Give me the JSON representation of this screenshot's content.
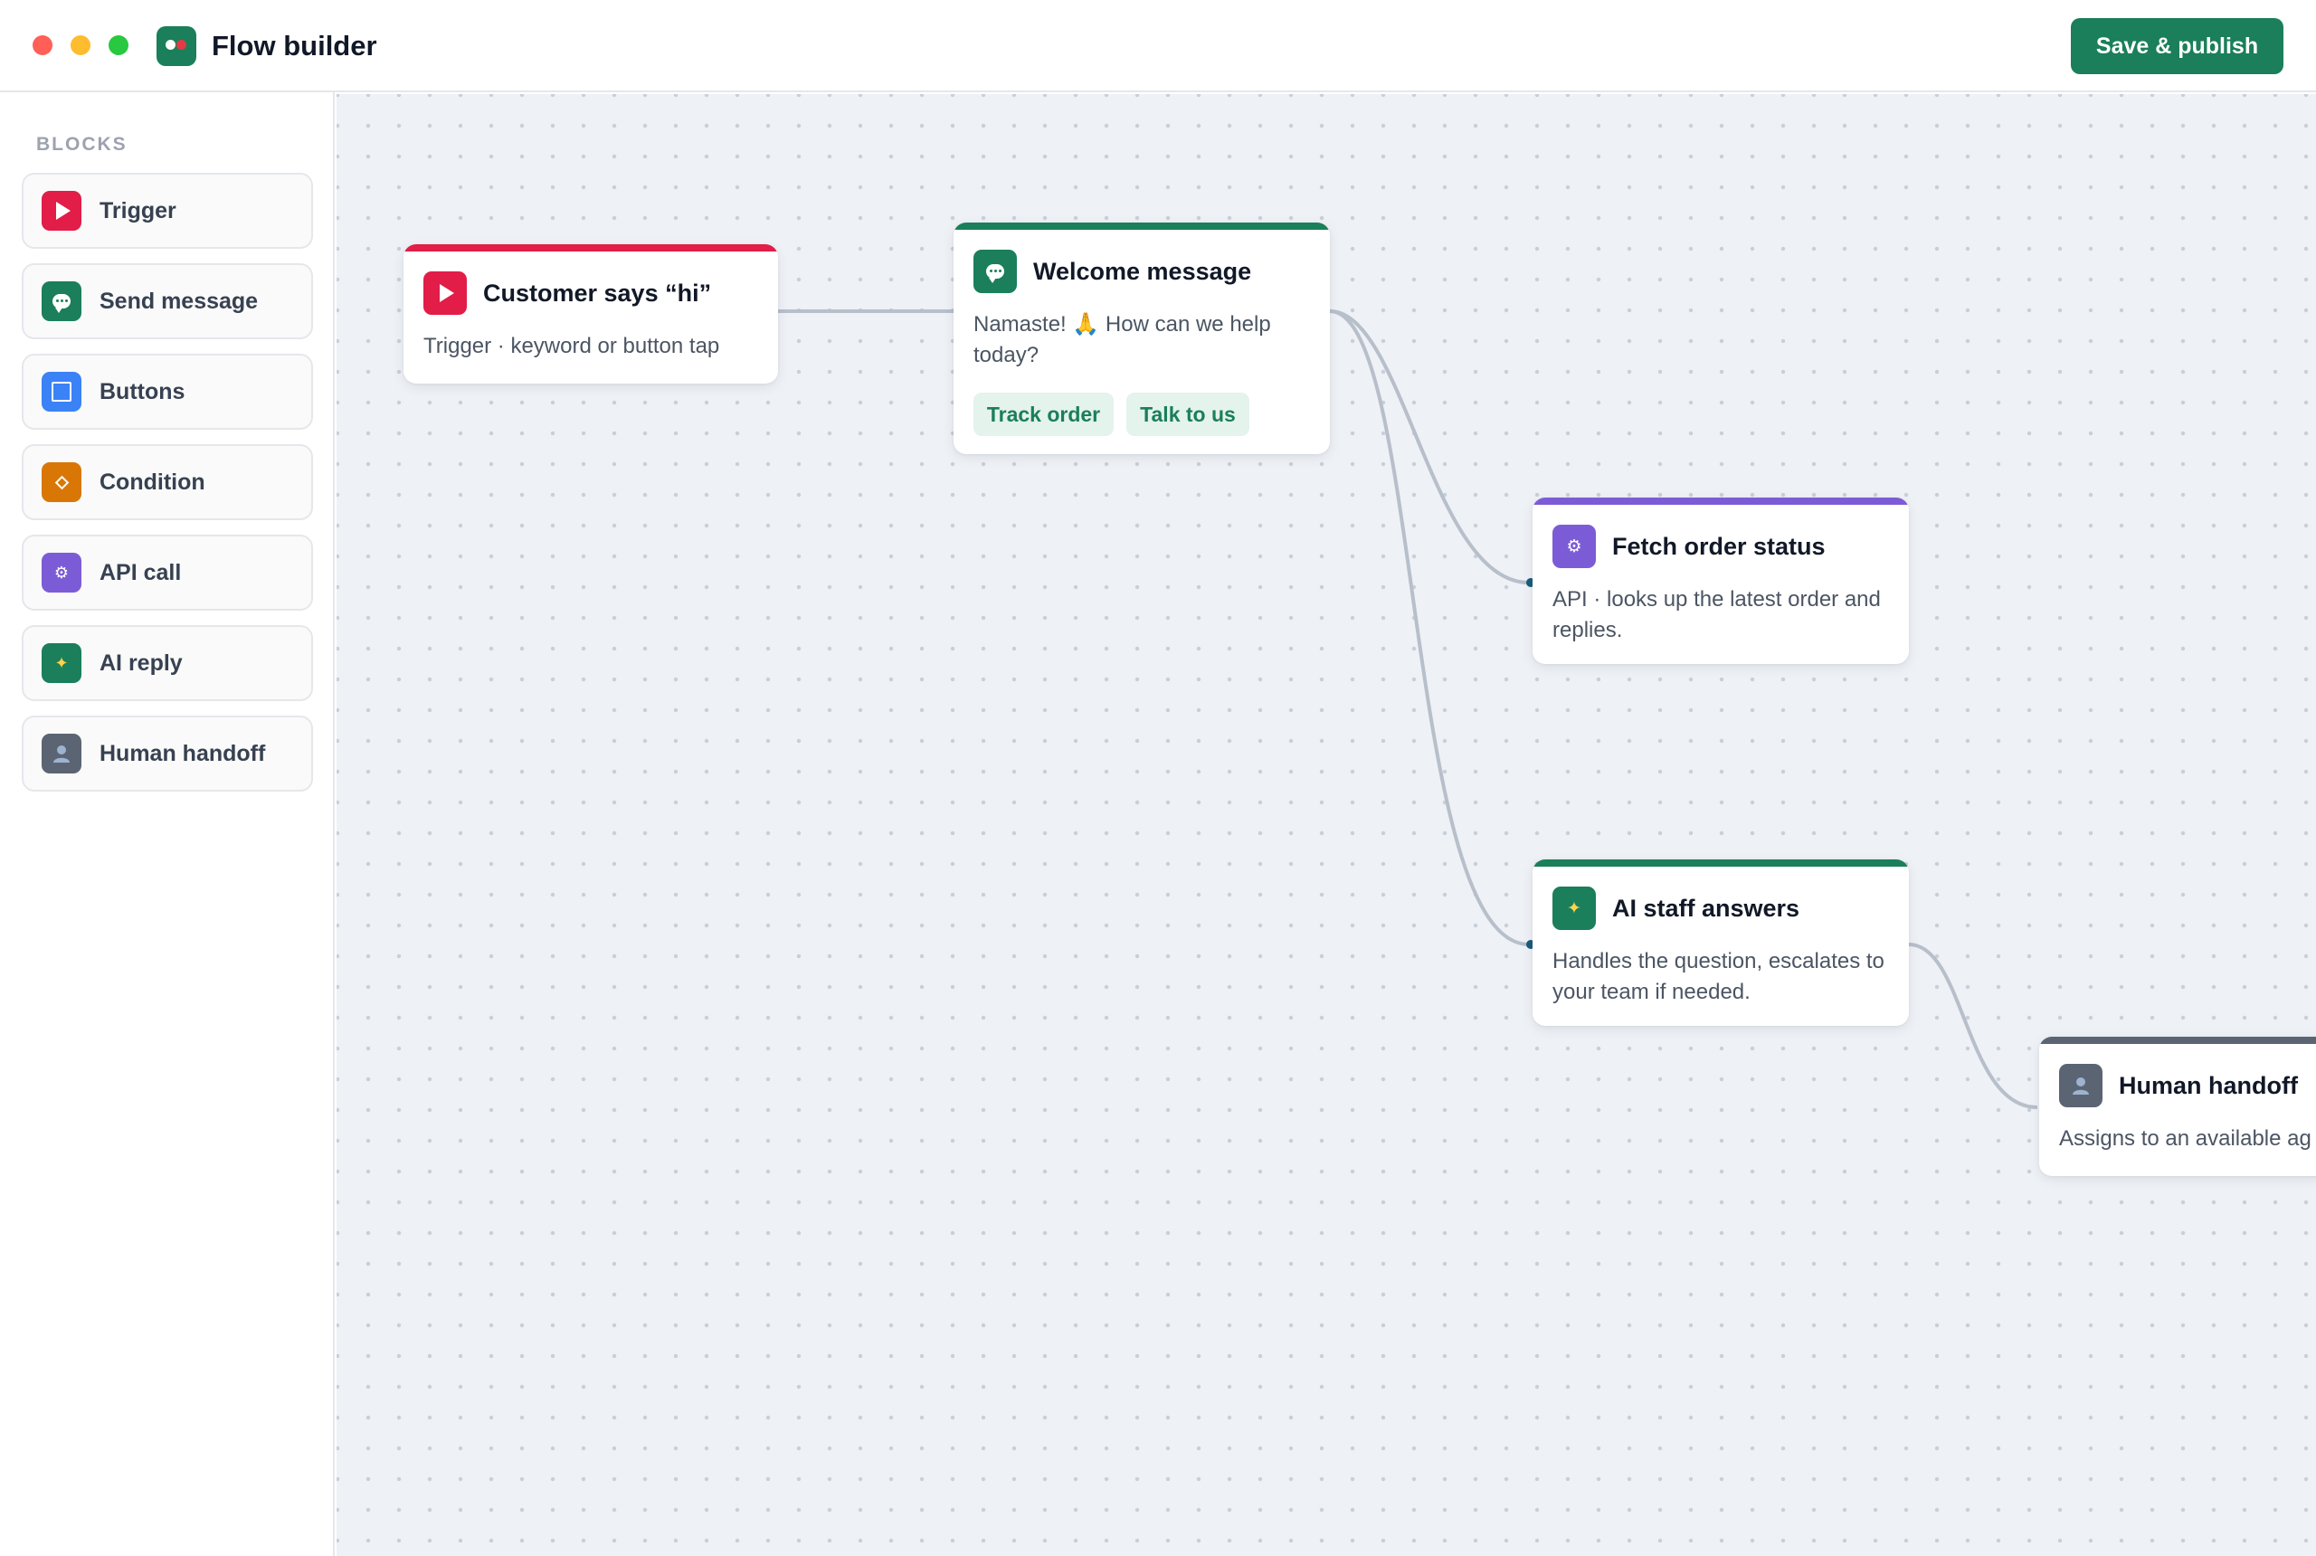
{
  "window": {
    "title": "Flow builder",
    "primary_action": "Save & publish"
  },
  "sidebar": {
    "heading": "BLOCKS",
    "items": [
      {
        "label": "Trigger",
        "icon": "play-icon",
        "color": "#e11d48"
      },
      {
        "label": "Send message",
        "icon": "chat-bubble-icon",
        "color": "#1a7f5a"
      },
      {
        "label": "Buttons",
        "icon": "square-icon",
        "color": "#3b82f6"
      },
      {
        "label": "Condition",
        "icon": "diamond-icon",
        "color": "#d97706"
      },
      {
        "label": "API call",
        "icon": "gear-icon",
        "color": "#7c5cd6"
      },
      {
        "label": "AI reply",
        "icon": "sparkles-icon",
        "color": "#1a7f5a"
      },
      {
        "label": "Human handoff",
        "icon": "person-icon",
        "color": "#5b6472"
      }
    ]
  },
  "canvas": {
    "nodes": {
      "trigger": {
        "title": "Customer says “hi”",
        "description": "Trigger · keyword or button tap",
        "accent": "#e11d48",
        "icon": "play-icon"
      },
      "welcome": {
        "title": "Welcome message",
        "description": "Namaste! 🙏 How can we help today?",
        "accent": "#1a7f5a",
        "icon": "chat-bubble-icon",
        "buttons": [
          "Track order",
          "Talk to us"
        ]
      },
      "fetch": {
        "title": "Fetch order status",
        "description": "API · looks up the latest order and replies.",
        "accent": "#7c5cd6",
        "icon": "gear-icon"
      },
      "ai": {
        "title": "AI staff answers",
        "description": "Handles the question, escalates to your team if needed.",
        "accent": "#1a7f5a",
        "icon": "sparkles-icon"
      },
      "handoff": {
        "title": "Human handoff",
        "description": "Assigns to an available ag",
        "accent": "#5b6472",
        "icon": "person-icon"
      }
    }
  },
  "colors": {
    "brand": "#1a7f5a",
    "canvas_bg": "#eef1f6",
    "wire": "#b7bfca"
  }
}
